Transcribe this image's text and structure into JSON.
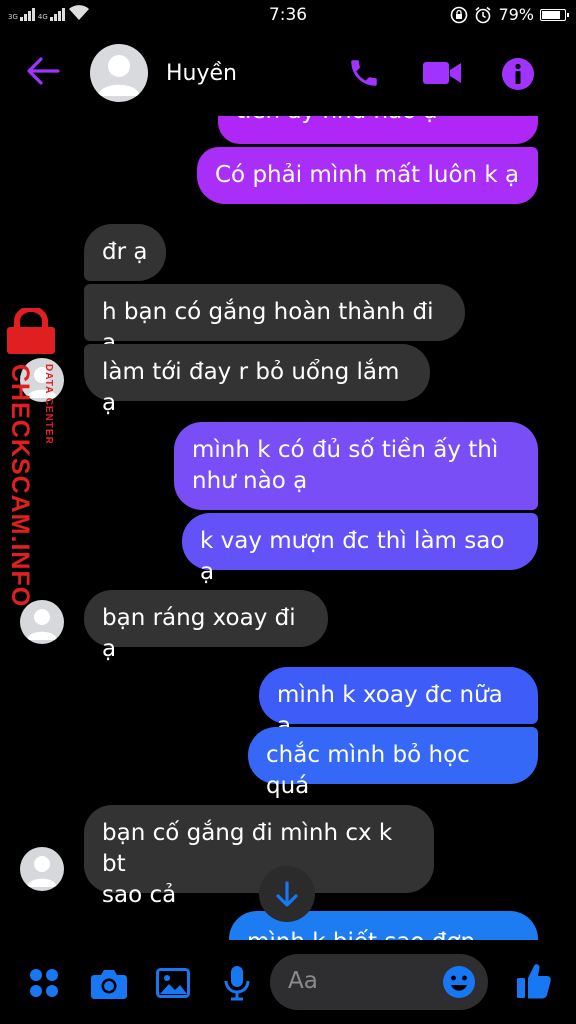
{
  "status_bar": {
    "signal1_label": "3G",
    "signal2_label": "4G",
    "time": "7:36",
    "battery": "79%"
  },
  "header": {
    "contact_name": "Huyền"
  },
  "watermark": {
    "main": "CHECKSCAM.INFO",
    "sub": "DATA CENTER"
  },
  "messages": [
    {
      "direction": "out",
      "text": "tiền ấy  như nào ạ",
      "partial": true
    },
    {
      "direction": "out",
      "text": "Có phải mình mất luôn  k ạ"
    },
    {
      "direction": "in",
      "text": "đr ạ"
    },
    {
      "direction": "in",
      "text": "h bạn có gắng hoàn thành đi ạ"
    },
    {
      "direction": "in",
      "text": "làm tới đay r bỏ uổng lắm ạ"
    },
    {
      "direction": "out",
      "line1": "mình k có đủ số tiền ấy thì",
      "line2": "như nào ạ"
    },
    {
      "direction": "out",
      "text": "k vay mượn đc thì làm sao ạ"
    },
    {
      "direction": "in",
      "text": "bạn ráng xoay đi ạ"
    },
    {
      "direction": "out",
      "text": "mình k xoay đc nữa ạ"
    },
    {
      "direction": "out",
      "text": "chắc mình bỏ học quá"
    },
    {
      "direction": "in",
      "line1": "bạn cố gắng đi mình cx k bt",
      "line2": "sao cả"
    },
    {
      "direction": "out",
      "text": "mình k biết sao đợn này",
      "partial": true
    }
  ],
  "composer": {
    "placeholder": "Aa"
  },
  "icons": {
    "back": "arrow-left-icon",
    "call": "phone-icon",
    "video": "video-camera-icon",
    "info": "info-icon",
    "menu": "four-dots-icon",
    "camera": "camera-icon",
    "gallery": "image-icon",
    "mic": "microphone-icon",
    "emoji": "smiley-icon",
    "like": "thumbs-up-icon",
    "scroll": "arrow-down-icon"
  },
  "colors": {
    "accent_purple": "#a033ff",
    "accent_blue": "#1877f2",
    "incoming_bubble": "#333334",
    "watermark_red": "#e02020"
  }
}
